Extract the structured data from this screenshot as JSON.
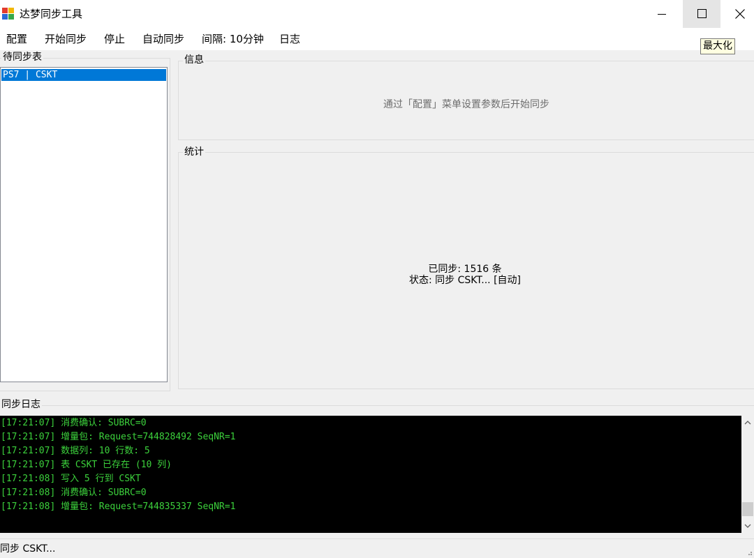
{
  "window": {
    "title": "达梦同步工具",
    "tooltip": "最大化"
  },
  "menu": {
    "config": "配置",
    "start_sync": "开始同步",
    "stop": "停止",
    "auto_sync": "自动同步",
    "interval": "间隔: 10分钟",
    "log": "日志"
  },
  "pending": {
    "title": "待同步表",
    "items": [
      "PS7 | CSKT"
    ]
  },
  "info": {
    "title": "信息",
    "hint": "通过「配置」菜单设置参数后开始同步"
  },
  "stats": {
    "title": "统计",
    "synced": "已同步: 1516 条",
    "status": "状态: 同步 CSKT... [自动]"
  },
  "log": {
    "title": "同步日志",
    "lines": [
      "[17:21:07] 消费确认: SUBRC=0",
      "[17:21:07] 增量包: Request=744828492 SeqNR=1",
      "[17:21:07] 数据列: 10 行数: 5",
      "[17:21:07] 表 CSKT 已存在 (10 列)",
      "[17:21:08] 写入 5 行到 CSKT",
      "[17:21:08] 消费确认: SUBRC=0",
      "[17:21:08] 增量包: Request=744835337 SeqNR=1"
    ]
  },
  "statusbar": {
    "text": "同步 CSKT..."
  },
  "colors": {
    "selection": "#0078d7",
    "log_text": "#3cd23c",
    "log_bg": "#000000"
  },
  "icons": {
    "app": "app-icon",
    "minimize": "minimize-icon",
    "maximize": "maximize-icon",
    "close": "close-icon",
    "scroll_up": "chevron-up-icon",
    "scroll_down": "chevron-down-icon"
  }
}
